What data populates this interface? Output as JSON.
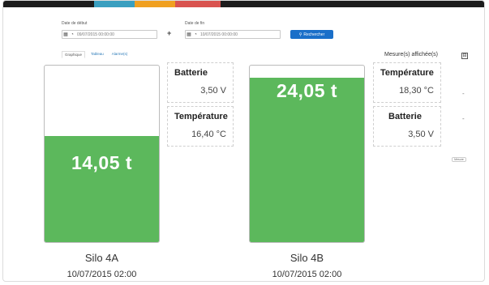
{
  "filters": {
    "start_label": "Date de début",
    "start_value": "09/07/2015 00:00:00",
    "end_label": "Date de fin",
    "end_value": "10/07/2015 00:00:00",
    "separator": "+",
    "search_label": "Rechercher"
  },
  "tabs": [
    {
      "label": "Graphique"
    },
    {
      "label": "Tableau"
    },
    {
      "label": "Alarme(s)"
    }
  ],
  "mesure": {
    "label": "Mesure(s) affichée(s)",
    "button": "⊟"
  },
  "silos": [
    {
      "name": "Silo 4A",
      "date": "10/07/2015 02:00",
      "weight": "14,05 t",
      "fill_fraction": 0.6,
      "measures": [
        {
          "title": "Batterie",
          "value": "3,50 V"
        },
        {
          "title": "Température",
          "value": "16,40 °C"
        }
      ]
    },
    {
      "name": "Silo 4B",
      "date": "10/07/2015 02:00",
      "weight": "24,05 t",
      "fill_fraction": 0.93,
      "measures": [
        {
          "title": "Température",
          "value": "18,30 °C"
        },
        {
          "title": "Batterie",
          "value": "3,50 V"
        }
      ]
    }
  ],
  "side_dashes": [
    "-",
    "-"
  ],
  "mini_button": "Mesure",
  "colors": {
    "fill": "#5cb85c",
    "primary": "#1a6fc9"
  }
}
